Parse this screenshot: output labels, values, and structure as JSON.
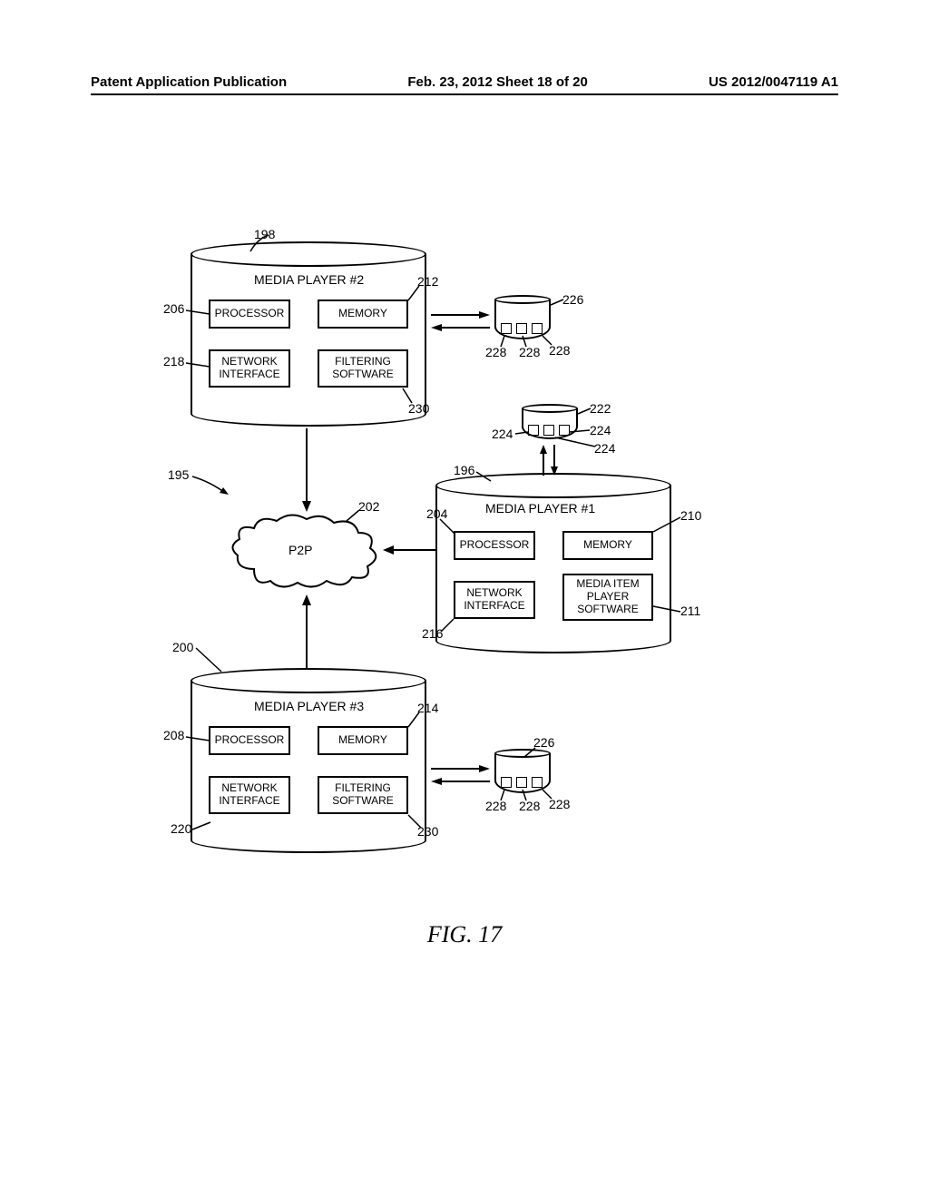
{
  "header": {
    "left": "Patent Application Publication",
    "mid": "Feb. 23, 2012  Sheet 18 of 20",
    "right": "US 2012/0047119 A1"
  },
  "figure_caption": "FIG. 17",
  "players": {
    "p2": {
      "title": "MEDIA PLAYER #2",
      "processor": "PROCESSOR",
      "memory": "MEMORY",
      "network": "NETWORK\nINTERFACE",
      "filtering": "FILTERING\nSOFTWARE"
    },
    "p1": {
      "title": "MEDIA PLAYER #1",
      "processor": "PROCESSOR",
      "memory": "MEMORY",
      "network": "NETWORK\nINTERFACE",
      "playersw": "MEDIA ITEM\nPLAYER\nSOFTWARE"
    },
    "p3": {
      "title": "MEDIA PLAYER #3",
      "processor": "PROCESSOR",
      "memory": "MEMORY",
      "network": "NETWORK\nINTERFACE",
      "filtering": "FILTERING\nSOFTWARE"
    }
  },
  "p2p": "P2P",
  "refs": {
    "r195": "195",
    "r196": "196",
    "r198": "198",
    "r200": "200",
    "r202": "202",
    "r204": "204",
    "r206": "206",
    "r208": "208",
    "r210": "210",
    "r211": "211",
    "r212": "212",
    "r214": "214",
    "r216": "216",
    "r218": "218",
    "r220": "220",
    "r222": "222",
    "r224a": "224",
    "r224b": "224",
    "r224c": "224",
    "r226a": "226",
    "r226b": "226",
    "r228a": "228",
    "r228b": "228",
    "r228c": "228",
    "r228d": "228",
    "r228e": "228",
    "r228f": "228",
    "r230a": "230",
    "r230b": "230"
  }
}
